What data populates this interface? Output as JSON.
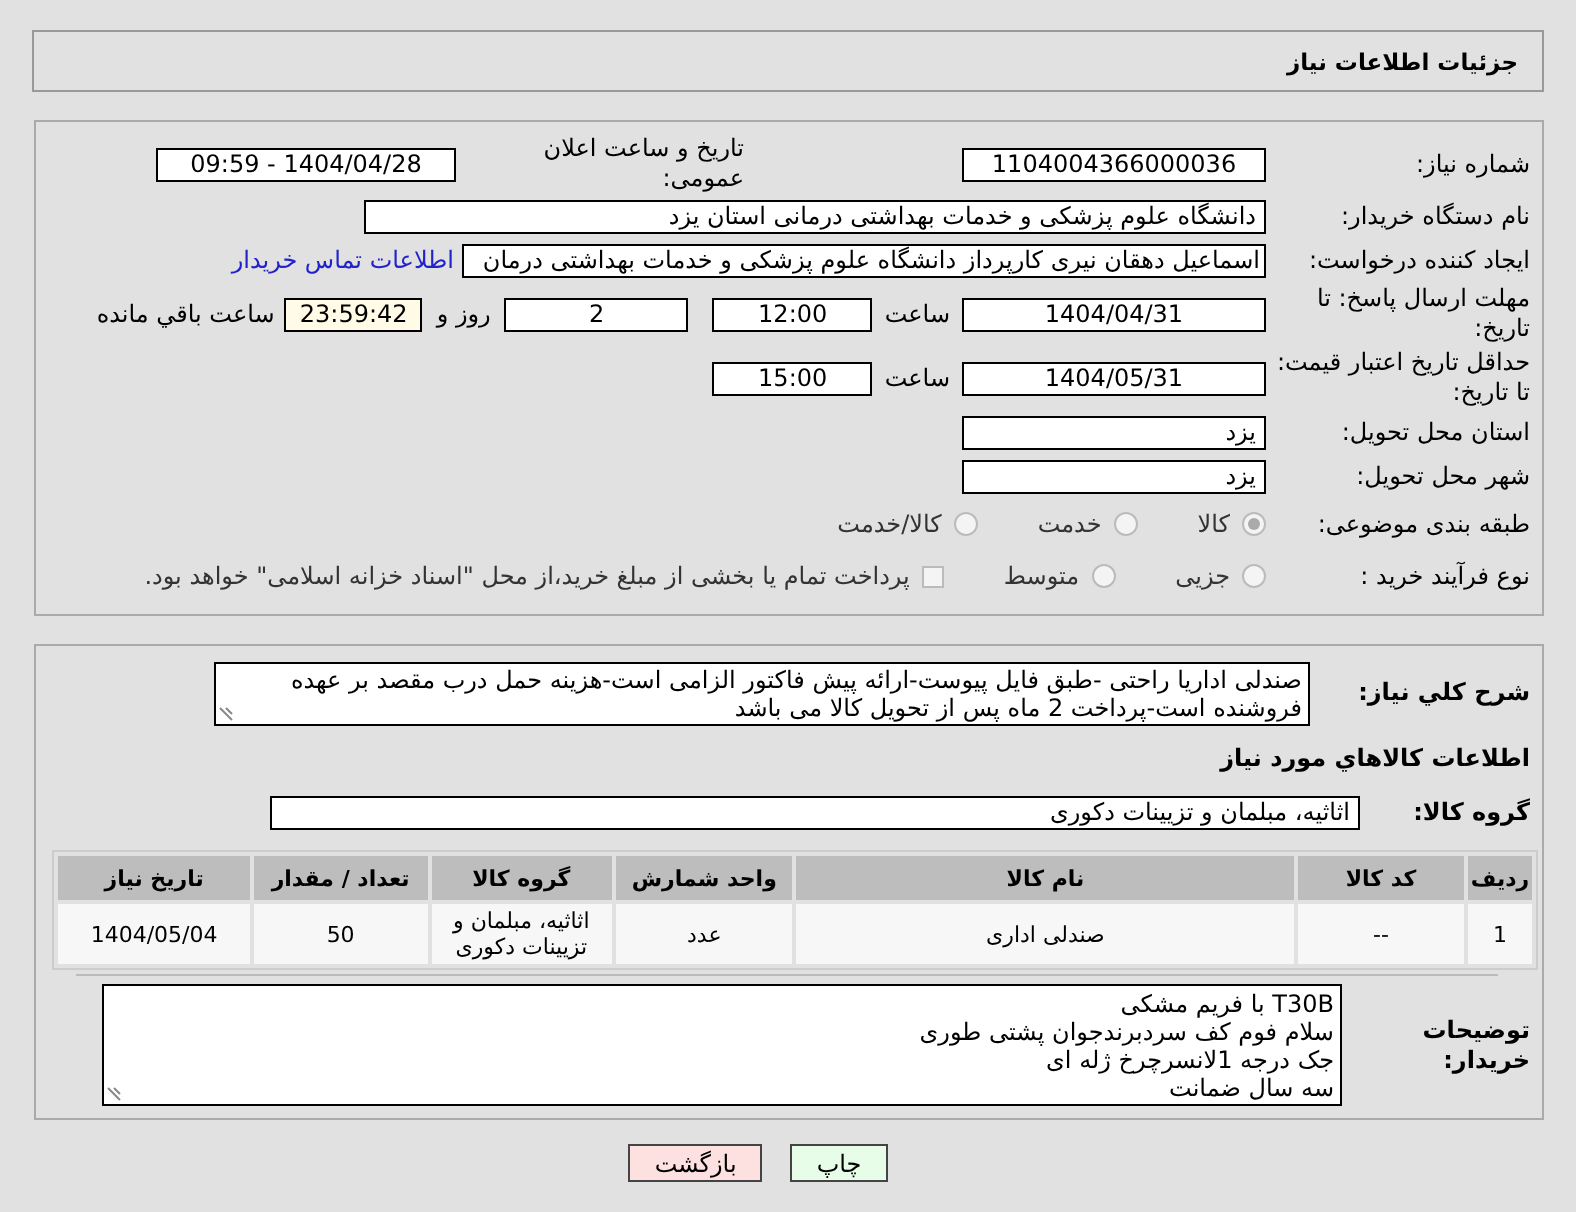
{
  "header": {
    "title": "جزئیات اطلاعات نیاز"
  },
  "details": {
    "need_number": {
      "label": "شماره نیاز:",
      "value": "1104004366000036"
    },
    "announce": {
      "label": "تاریخ و ساعت اعلان عمومی:",
      "value": "1404/04/28 - 09:59"
    },
    "buyer_org": {
      "label": "نام دستگاه خریدار:",
      "value": "دانشگاه علوم پزشکی و خدمات بهداشتی  درمانی استان یزد"
    },
    "creator": {
      "label": "ایجاد کننده درخواست:",
      "value": "اسماعیل دهقان نیری کارپرداز دانشگاه علوم پزشکی و خدمات بهداشتی  درمان",
      "link": "اطلاعات تماس خریدار"
    },
    "deadline": {
      "label": "مهلت ارسال پاسخ: تا تاریخ:",
      "date": "1404/04/31",
      "time_label": "ساعت",
      "time": "12:00",
      "days": "2",
      "days_label": "روز و",
      "remaining": "23:59:42",
      "remaining_label": "ساعت باقي مانده"
    },
    "validity": {
      "label": "حداقل تاریخ اعتبار قیمت: تا تاریخ:",
      "date": "1404/05/31",
      "time_label": "ساعت",
      "time": "15:00"
    },
    "province": {
      "label": "استان محل تحویل:",
      "value": "یزد"
    },
    "city": {
      "label": "شهر محل تحویل:",
      "value": "یزد"
    },
    "category": {
      "label": "طبقه بندی موضوعی:",
      "options": [
        {
          "label": "کالا",
          "selected": true
        },
        {
          "label": "خدمت",
          "selected": false
        },
        {
          "label": "کالا/خدمت",
          "selected": false
        }
      ]
    },
    "process": {
      "label": "نوع فرآیند خرید :",
      "options": [
        {
          "label": "جزیی",
          "selected": false
        },
        {
          "label": "متوسط",
          "selected": false
        }
      ],
      "treasury": {
        "label": "پرداخت تمام یا بخشی از مبلغ خرید،از محل \"اسناد خزانه اسلامی\" خواهد بود.",
        "checked": false
      }
    }
  },
  "goods": {
    "description": {
      "label": "شرح کلي نیاز:",
      "value": "صندلی اداریا راحتی -طبق فایل پیوست-ارائه پیش فاکتور الزامی است-هزینه حمل درب مقصد بر عهده فروشنده است-پرداخت 2 ماه پس از تحویل کالا می باشد"
    },
    "heading": "اطلاعات کالاهاي مورد نیاز",
    "group": {
      "label": "گروه کالا:",
      "value": "اثاثیه، مبلمان و تزیینات دکوری"
    },
    "table": {
      "columns": [
        "ردیف",
        "کد کالا",
        "نام کالا",
        "واحد شمارش",
        "گروه کالا",
        "تعداد / مقدار",
        "تاریخ نیاز"
      ],
      "rows": [
        [
          "1",
          "--",
          "صندلی اداری",
          "عدد",
          "اثاثیه، مبلمان و تزیینات دکوری",
          "50",
          "1404/05/04"
        ]
      ]
    },
    "buyer_notes": {
      "label": "توضیحات خریدار:",
      "lines": [
        "T30B با فریم مشکی",
        "سلام فوم کف سردبرندجوان پشتی طوری",
        "جک درجه 1لانسرچرخ ژله ای",
        "سه سال ضمانت"
      ]
    }
  },
  "buttons": [
    {
      "label": "چاپ",
      "kind": "print"
    },
    {
      "label": "بازگشت",
      "kind": "back"
    }
  ]
}
